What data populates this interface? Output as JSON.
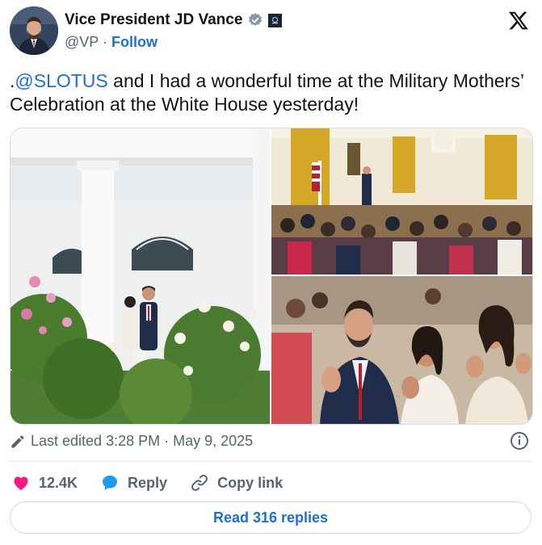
{
  "author": {
    "name": "Vice President JD Vance",
    "handle": "@VP",
    "separator": "·",
    "follow_label": "Follow"
  },
  "tweet": {
    "text_prefix": ".",
    "mention": "@SLOTUS",
    "text_rest": " and I had a wonderful time at the Military Mothers’ Celebration at the White House yesterday!"
  },
  "meta": {
    "edited_text": "Last edited 3:28 PM · May 9, 2025"
  },
  "actions": {
    "likes": "12.4K",
    "reply_label": "Reply",
    "copy_label": "Copy link"
  },
  "read_replies_label": "Read 316 replies",
  "colors": {
    "accent": "#1d6fd6",
    "like": "#f91880",
    "secondary_text": "#536471"
  },
  "icons": [
    "verified-badge-icon",
    "government-badge-icon",
    "x-logo-icon",
    "edit-pencil-icon",
    "info-icon",
    "heart-icon",
    "reply-bubble-icon",
    "link-icon"
  ]
}
